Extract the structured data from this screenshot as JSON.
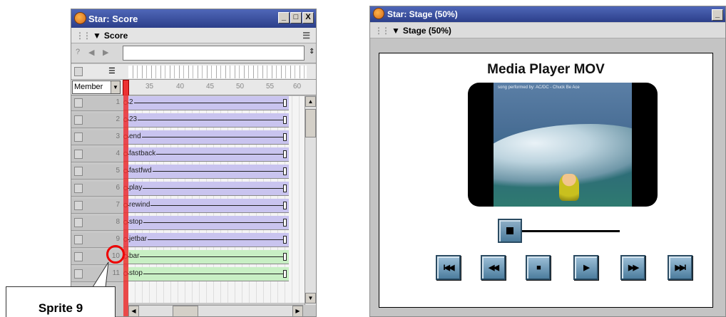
{
  "score_window": {
    "title": "Star: Score",
    "panel_label": "Score",
    "window_buttons": [
      "_",
      "□",
      "X"
    ],
    "member_select": "Member",
    "ruler_ticks": [
      "35",
      "40",
      "45",
      "50",
      "55",
      "60"
    ],
    "sprite_rows": [
      {
        "channel": "1",
        "label": "2",
        "color": "purple"
      },
      {
        "channel": "2",
        "label": "23",
        "color": "purple"
      },
      {
        "channel": "3",
        "label": "end",
        "color": "purple"
      },
      {
        "channel": "4",
        "label": "fastback",
        "color": "purple"
      },
      {
        "channel": "5",
        "label": "fastfwd",
        "color": "purple"
      },
      {
        "channel": "6",
        "label": "play",
        "color": "purple"
      },
      {
        "channel": "7",
        "label": "rewind",
        "color": "purple"
      },
      {
        "channel": "8",
        "label": "stop",
        "color": "purple"
      },
      {
        "channel": "9",
        "label": "jetbar",
        "color": "purple"
      },
      {
        "channel": "10",
        "label": "bar",
        "color": "green"
      },
      {
        "channel": "11",
        "label": "stop",
        "color": "green"
      }
    ]
  },
  "callout": {
    "label": "Sprite 9",
    "color": "#ee0000"
  },
  "stage_window": {
    "title": "Star: Stage (50%)",
    "panel_label": "Stage (50%)",
    "heading": "Media Player MOV",
    "video_caption": "song performed by: AC/DC - Chuck Be Ace",
    "controls": [
      {
        "name": "first-frame",
        "glyph": "I◀◀"
      },
      {
        "name": "rewind",
        "glyph": "◀◀"
      },
      {
        "name": "stop",
        "glyph": "■"
      },
      {
        "name": "play",
        "glyph": "▶"
      },
      {
        "name": "fast-forward",
        "glyph": "▶▶"
      },
      {
        "name": "last-frame",
        "glyph": "▶▶I"
      }
    ]
  },
  "colors": {
    "titlebar": "#2c3f8a",
    "sprite_purple": "#c9c4ef",
    "sprite_green": "#c8efc4",
    "control_button": "#4c7d9e"
  }
}
